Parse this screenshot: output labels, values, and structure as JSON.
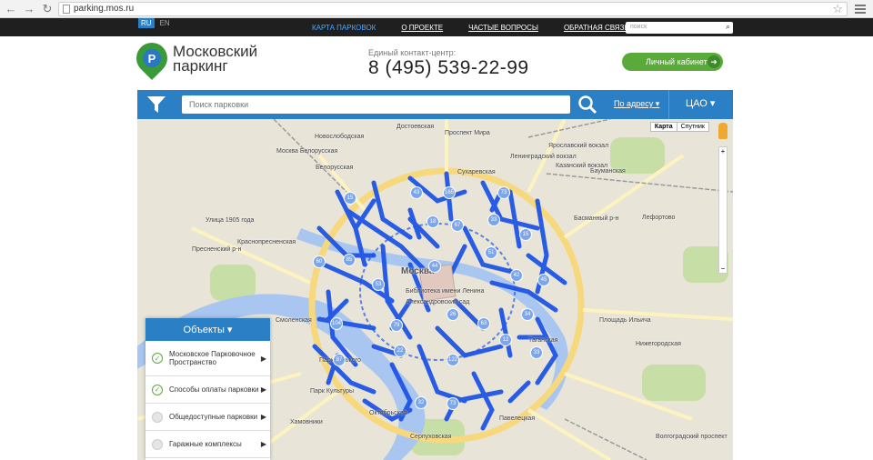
{
  "browser": {
    "back": "←",
    "forward": "→",
    "reload": "↻",
    "url": "parking.mos.ru",
    "bookmark": "☆"
  },
  "topnav": {
    "lang_ru": "RU",
    "lang_en": "EN",
    "links": [
      "КАРТА ПАРКОВОК",
      "О ПРОЕКТЕ",
      "ЧАСТЫЕ ВОПРОСЫ",
      "ОБРАТНАЯ СВЯЗЬ"
    ],
    "search_placeholder": "поиск",
    "search_icon": "🔍"
  },
  "header": {
    "logo_letter": "P",
    "logo_line1": "Московский",
    "logo_line2": "паркинг",
    "contact_label": "Единый контакт-центр:",
    "phone": "8 (495) 539-22-99",
    "cabinet_label": "Личный кабинет",
    "cabinet_arrow": "➜"
  },
  "searchbar": {
    "placeholder": "Поиск парковки",
    "by_address": "По адресу ▾",
    "district": "ЦАО ▾"
  },
  "map": {
    "toggle_map": "Карта",
    "toggle_satellite": "Спутник",
    "zoom_plus": "+",
    "zoom_minus": "−",
    "labels": [
      "Достоевская",
      "Новослободская",
      "Проспект Мира",
      "Сухаревская",
      "Ярославский вокзал",
      "Ленинградский вокзал",
      "Казанский вокзал",
      "Бауманская",
      "Москва Белорусская",
      "Белорусская",
      "Улица 1905 года",
      "Краснопресненская",
      "Пресненский р-н",
      "Басманный р-н",
      "Лефортово",
      "Москва",
      "Библиотека имени Ленина",
      "Александровский сад",
      "Смоленская",
      "Парк Культуры",
      "Октябрьская",
      "Павелецкая",
      "Таганская",
      "Серпуховская",
      "Площадь Ильича",
      "Нижегородская",
      "Волгоградский проспект",
      "Парк Горького",
      "Хамовники"
    ],
    "clusters": [
      "15",
      "43",
      "165",
      "73",
      "18",
      "33",
      "67",
      "15",
      "60",
      "85",
      "53",
      "44",
      "51",
      "42",
      "45",
      "104",
      "79",
      "26",
      "63",
      "34",
      "12",
      "33",
      "32",
      "122",
      "87",
      "73",
      "22"
    ]
  },
  "objects": {
    "title": "Объекты ▾",
    "items": [
      {
        "label": "Московское Парковочное Пространство",
        "checked": true
      },
      {
        "label": "Способы оплаты парковки",
        "checked": true
      },
      {
        "label": "Общедоступные парковки",
        "checked": false
      },
      {
        "label": "Гаражные комплексы",
        "checked": false
      }
    ],
    "arrow": "▶",
    "check": "✓"
  },
  "colors": {
    "brand_blue": "#2b7fc4",
    "brand_green": "#5aaa3a",
    "parking_line": "#1f55e6"
  }
}
